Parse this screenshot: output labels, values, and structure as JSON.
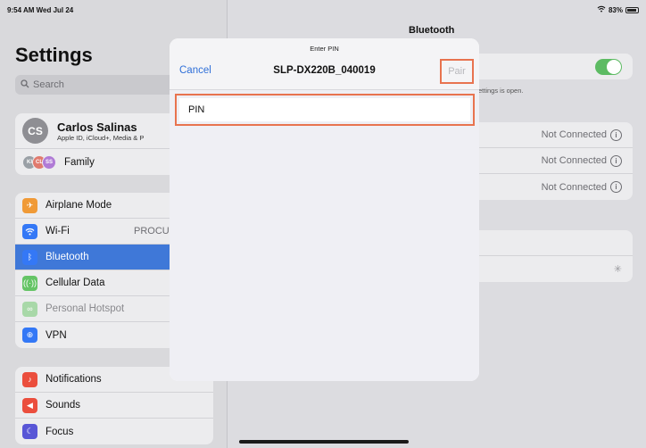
{
  "status_bar": {
    "time": "9:54 AM  Wed Jul 24",
    "battery": "83%"
  },
  "sidebar": {
    "title": "Settings",
    "search_placeholder": "Search",
    "account": {
      "initials": "CS",
      "name": "Carlos Salinas",
      "subtitle": "Apple ID, iCloud+, Media & P"
    },
    "family": {
      "label": "Family",
      "avatars": [
        "KI",
        "CL",
        "SS"
      ]
    },
    "group1": [
      {
        "label": "Airplane Mode",
        "icon": "airplane-icon",
        "color": "#f09a37"
      },
      {
        "label": "Wi-Fi",
        "icon": "wifi-icon",
        "color": "#3478f6",
        "extra": "PROCU"
      },
      {
        "label": "Bluetooth",
        "icon": "bluetooth-icon",
        "color": "#3478f6"
      },
      {
        "label": "Cellular Data",
        "icon": "antenna-icon",
        "color": "#65c466"
      },
      {
        "label": "Personal Hotspot",
        "icon": "hotspot-icon",
        "color": "#65c466"
      },
      {
        "label": "VPN",
        "icon": "globe-icon",
        "color": "#3478f6"
      }
    ],
    "group2": [
      {
        "label": "Notifications",
        "icon": "bell-icon",
        "color": "#eb4e3d"
      },
      {
        "label": "Sounds",
        "icon": "speaker-icon",
        "color": "#eb4e3d"
      },
      {
        "label": "Focus",
        "icon": "moon-icon",
        "color": "#5856d6"
      }
    ]
  },
  "detail": {
    "title": "Bluetooth",
    "note": "ettings is open.",
    "devices": [
      {
        "status": "Not Connected"
      },
      {
        "status": "Not Connected"
      },
      {
        "status": "Not Connected"
      }
    ]
  },
  "modal": {
    "prompt": "Enter PIN",
    "title": "SLP-DX220B_040019",
    "cancel_label": "Cancel",
    "pair_label": "Pair",
    "pin_placeholder": "PIN"
  },
  "colors": {
    "accent": "#2f6fd8",
    "highlight": "#e8734f",
    "toggle_on": "#5dbb63"
  }
}
